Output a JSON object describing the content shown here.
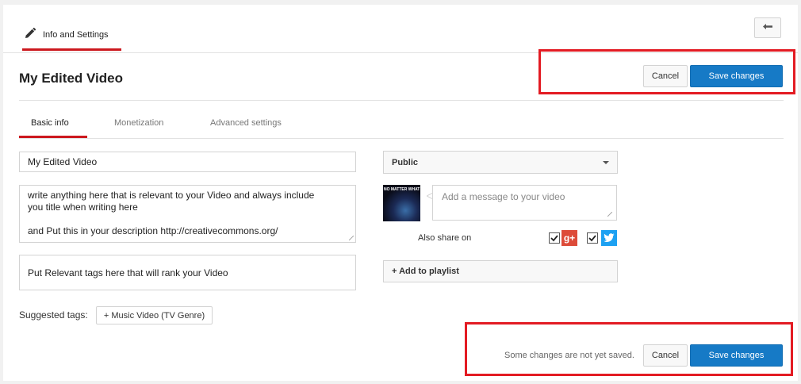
{
  "header": {
    "tab_label": "Info and Settings",
    "back_icon": "back-arrow-icon",
    "edit_icon": "pencil-icon"
  },
  "video": {
    "title": "My Edited Video"
  },
  "actions": {
    "cancel_label": "Cancel",
    "save_label": "Save changes",
    "unsaved_notice": "Some changes are not yet saved."
  },
  "tabs": [
    {
      "label": "Basic info",
      "active": true
    },
    {
      "label": "Monetization",
      "active": false
    },
    {
      "label": "Advanced settings",
      "active": false
    }
  ],
  "form": {
    "title_value": "My Edited Video",
    "description_lines": [
      "write anything here that is relevant to your Video and always include",
      "you title when writing here",
      "",
      "and Put this in your description http://creativecommons.org/"
    ],
    "tags_value": "Put Relevant tags here that will rank your Video",
    "suggested_tags_label": "Suggested tags:",
    "suggested_tags": [
      "+ Music Video (TV Genre)"
    ]
  },
  "privacy": {
    "selected": "Public"
  },
  "share": {
    "message_placeholder": "Add a message to your video",
    "also_share_label": "Also share on",
    "thumbnail_text": "NO MATTER WHAT",
    "networks": [
      {
        "name": "google-plus",
        "icon": "google-plus-icon",
        "glyph": "g+",
        "checked": true
      },
      {
        "name": "twitter",
        "icon": "twitter-icon",
        "checked": true
      }
    ]
  },
  "playlist": {
    "add_label": "+ Add to playlist"
  },
  "colors": {
    "accent_red": "#cc181e",
    "highlight_red": "#e31b23",
    "primary_blue": "#167ac6",
    "google_red": "#dd4b39",
    "twitter_blue": "#1da1f2"
  }
}
